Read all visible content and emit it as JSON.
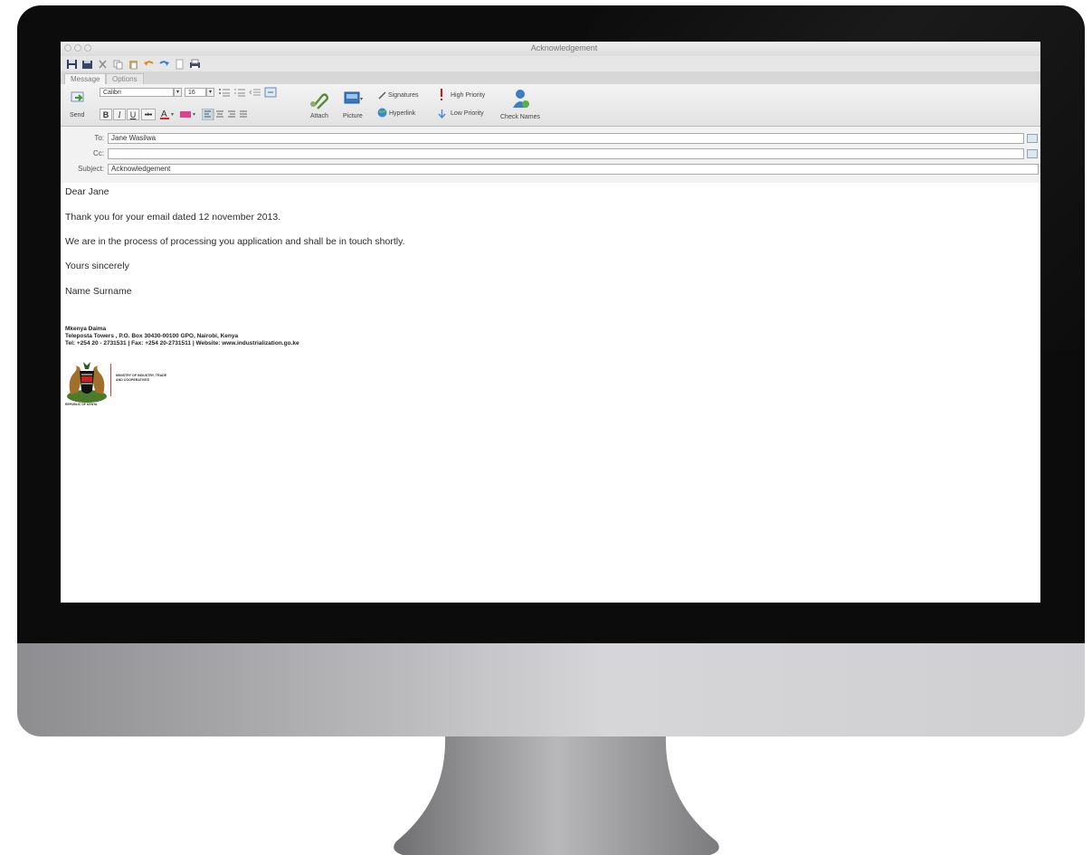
{
  "window": {
    "title": "Acknowledgement"
  },
  "tabs": [
    {
      "label": "Message"
    },
    {
      "label": "Options"
    }
  ],
  "ribbon": {
    "send_label": "Send",
    "font_name": "Calibri",
    "font_size": "16",
    "bold": "B",
    "italic": "I",
    "underline": "U",
    "attach_label": "Attach",
    "picture_label": "Picture",
    "signatures_label": "Signatures",
    "hyperlink_label": "Hyperlink",
    "high_priority_label": "High Priority",
    "low_priority_label": "Low Priority",
    "check_names_label": "Check Names"
  },
  "fields": {
    "to_label": "To:",
    "to_value": "Jane Wasilwa",
    "cc_label": "Cc:",
    "cc_value": "",
    "subject_label": "Subject:",
    "subject_value": "Acknowledgement"
  },
  "body": {
    "greeting": "Dear Jane",
    "line1": "Thank you for your email dated 12 november 2013.",
    "line2": "We are in the process of processing you application and shall be in touch shortly.",
    "closing": "Yours sincerely",
    "name": "Name Surname"
  },
  "signature": {
    "org": "Mkenya Daima",
    "address": "Teleposta Towers , P.O. Box 30430-00100 GPO, Nairobi, Kenya",
    "contact": "Tel: +254 20 - 2731531 | Fax: +254 20-2731511 | Website: www.industrialization.go.ke",
    "ministry": "MINISTRY OF INDUSTRY, TRADE AND COOPERATIVES",
    "republic": "REPUBLIC OF KENYA"
  },
  "colors": {
    "bezel": "#0c0c0c",
    "chin": "#c4c4c6",
    "stand": "#a0a0a2"
  }
}
